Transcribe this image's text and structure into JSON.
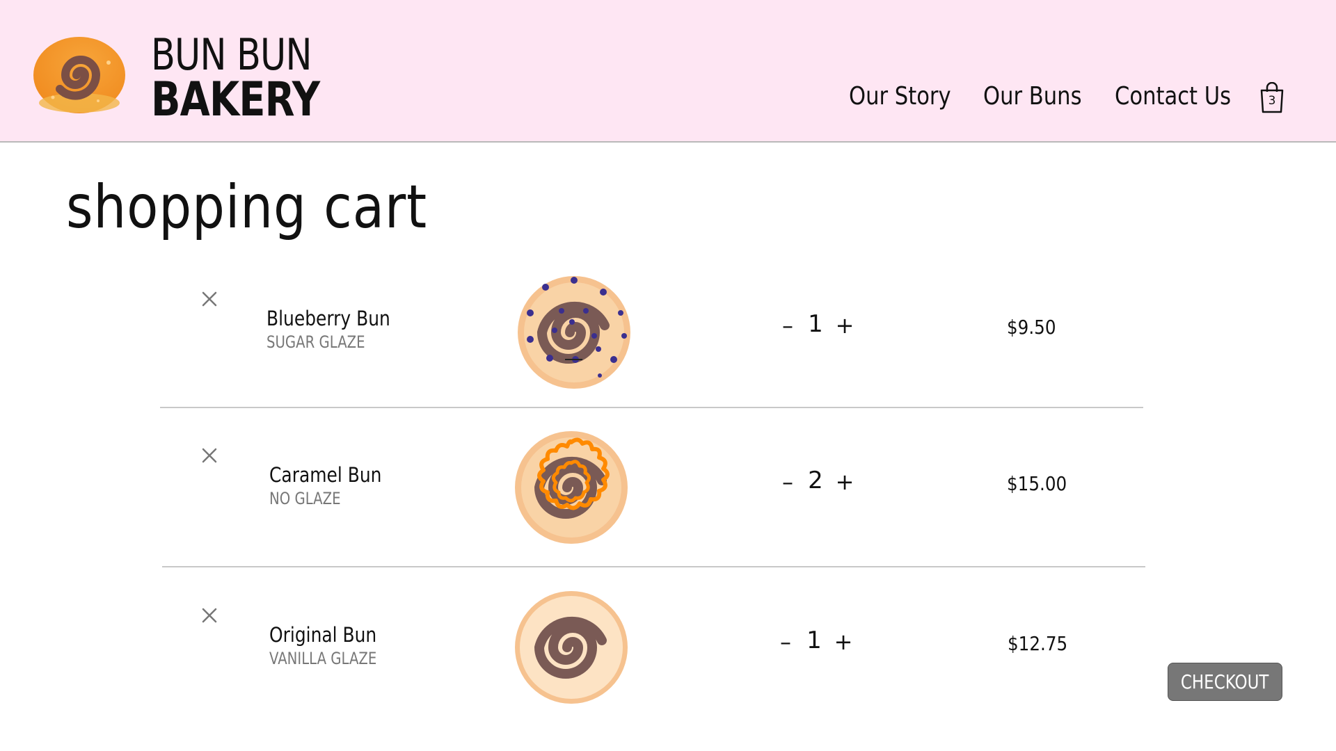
{
  "brand": {
    "line1": "BUN BUN",
    "line2": "BAKERY"
  },
  "nav": {
    "our_story": "Our Story",
    "our_buns": "Our Buns",
    "contact_us": "Contact Us"
  },
  "cart_badge": {
    "count": "3",
    "icon": "shopping-bag-icon"
  },
  "page": {
    "title": "shopping cart"
  },
  "items": [
    {
      "name": "Blueberry Bun",
      "glaze": "SUGAR GLAZE",
      "quantity": "1",
      "price": "$9.50",
      "image": "blueberry-bun-image"
    },
    {
      "name": "Caramel Bun",
      "glaze": "NO GLAZE",
      "quantity": "2",
      "price": "$15.00",
      "image": "caramel-bun-image"
    },
    {
      "name": "Original Bun",
      "glaze": "VANILLA GLAZE",
      "quantity": "1",
      "price": "$12.75",
      "image": "original-bun-image"
    }
  ],
  "controls": {
    "minus": "–",
    "plus": "+",
    "remove_icon": "close-icon"
  },
  "checkout": {
    "label": "CHECKOUT"
  },
  "colors": {
    "header_bg": "#fee6f3",
    "checkout_bg": "#777777",
    "bun_dough": "#f6c28f",
    "bun_swirl": "#7a5a55",
    "blueberry": "#3b2f8f",
    "caramel": "#ff8a00"
  }
}
